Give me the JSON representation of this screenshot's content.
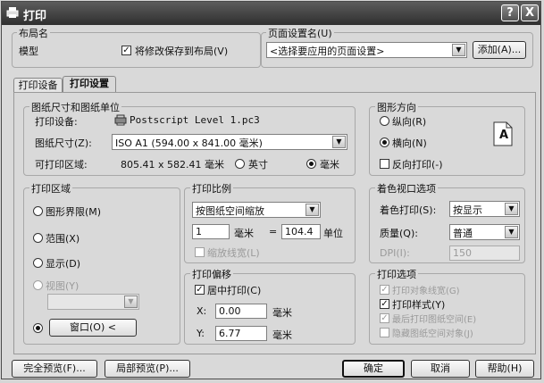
{
  "window": {
    "title": "打印",
    "help_btn": "?",
    "close_btn": "X"
  },
  "layout_name": {
    "label": "布局名",
    "value": "模型",
    "save_checkbox": "将修改保存到布局(V)",
    "save_checked": true
  },
  "page_setup": {
    "label": "页面设置名(U)",
    "value": "<选择要应用的页面设置>",
    "add_button": "添加(A)..."
  },
  "tabs": [
    {
      "label": "打印设备",
      "active": false
    },
    {
      "label": "打印设置",
      "active": true
    }
  ],
  "paper": {
    "group_label": "图纸尺寸和图纸单位",
    "device_label": "打印设备:",
    "device_value": "Postscript Level 1.pc3",
    "size_label": "图纸尺寸(Z):",
    "size_value": "ISO A1 (594.00 x 841.00 毫米)",
    "area_label": "可打印区域:",
    "area_value": "805.41 x 582.41 毫米",
    "unit_inch": "英寸",
    "unit_mm": "毫米",
    "unit_selected": "mm"
  },
  "orientation": {
    "group_label": "图形方向",
    "portrait": "纵向(R)",
    "landscape": "横向(N)",
    "selected": "landscape",
    "reverse": "反向打印(-)",
    "reverse_checked": false,
    "preview_letter": "A"
  },
  "plot_area": {
    "group_label": "打印区域",
    "options": [
      "图形界限(M)",
      "范围(X)",
      "显示(D)",
      "视图(Y)",
      "窗口(O)"
    ],
    "selected": 4,
    "window_button": "窗口(O) <"
  },
  "plot_scale": {
    "group_label": "打印比例",
    "scale_value": "按图纸空间缩放",
    "value1": "1",
    "unit1": "毫米",
    "equals": "=",
    "value2": "104.4",
    "unit2": "单位",
    "scale_lineweights": "缩放线宽(L)",
    "scale_lineweights_checked": false
  },
  "plot_offset": {
    "group_label": "打印偏移",
    "center": "居中打印(C)",
    "center_checked": true,
    "x_label": "X:",
    "x_value": "0.00",
    "x_unit": "毫米",
    "y_label": "Y:",
    "y_value": "6.77",
    "y_unit": "毫米"
  },
  "shaded": {
    "group_label": "着色视口选项",
    "shade_label": "着色打印(S):",
    "shade_value": "按显示",
    "quality_label": "质量(Q):",
    "quality_value": "普通",
    "dpi_label": "DPI(I):",
    "dpi_value": "150"
  },
  "plot_options": {
    "group_label": "打印选项",
    "items": [
      {
        "label": "打印对象线宽(G)",
        "checked": true,
        "disabled": true
      },
      {
        "label": "打印样式(Y)",
        "checked": true,
        "disabled": false
      },
      {
        "label": "最后打印图纸空间(E)",
        "checked": true,
        "disabled": true
      },
      {
        "label": "隐藏图纸空间对象(J)",
        "checked": false,
        "disabled": true
      }
    ]
  },
  "footer": {
    "full_preview": "完全预览(F)...",
    "partial_preview": "局部预览(P)...",
    "ok": "确定",
    "cancel": "取消",
    "help": "帮助(H)"
  },
  "colors": {
    "titlebar": "#3d3d3d",
    "dialog_bg": "#d9d9d9"
  }
}
